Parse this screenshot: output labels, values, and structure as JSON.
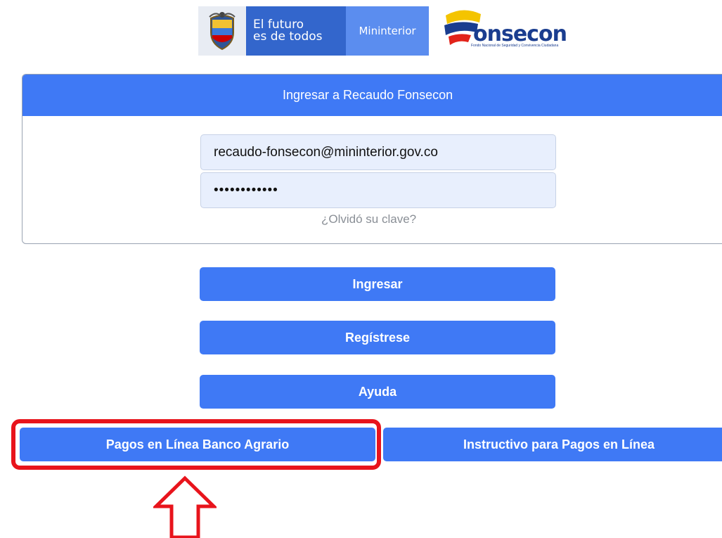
{
  "header": {
    "gov_logo": {
      "tagline_line1": "El futuro",
      "tagline_line2": "es de todos",
      "ministry": "Mininterior",
      "shield_icon": "colombia-coat-of-arms-icon"
    },
    "fonsecon_logo": {
      "word": "onsecon",
      "tagline": "Fondo Nacional de Seguridad y Convivencia Ciudadana",
      "colors": {
        "yellow": "#f4c400",
        "blue": "#1a3d8f",
        "red": "#e2231a"
      }
    }
  },
  "login_card": {
    "title": "Ingresar a Recaudo Fonsecon",
    "email_value": "recaudo-fonsecon@mininterior.gov.co",
    "password_value": "••••••••••••",
    "forgot_link": "¿Olvidó su clave?"
  },
  "buttons": {
    "ingresar": "Ingresar",
    "registrese": "Regístrese",
    "ayuda": "Ayuda",
    "pagos_en_linea": "Pagos en Línea Banco Agrario",
    "instructivo": "Instructivo para Pagos en Línea"
  },
  "annotation": {
    "highlight_color": "#e8141c",
    "arrow_icon": "up-arrow-outline-icon"
  },
  "theme": {
    "primary": "#3f79f5",
    "field_bg": "#e8effd"
  }
}
